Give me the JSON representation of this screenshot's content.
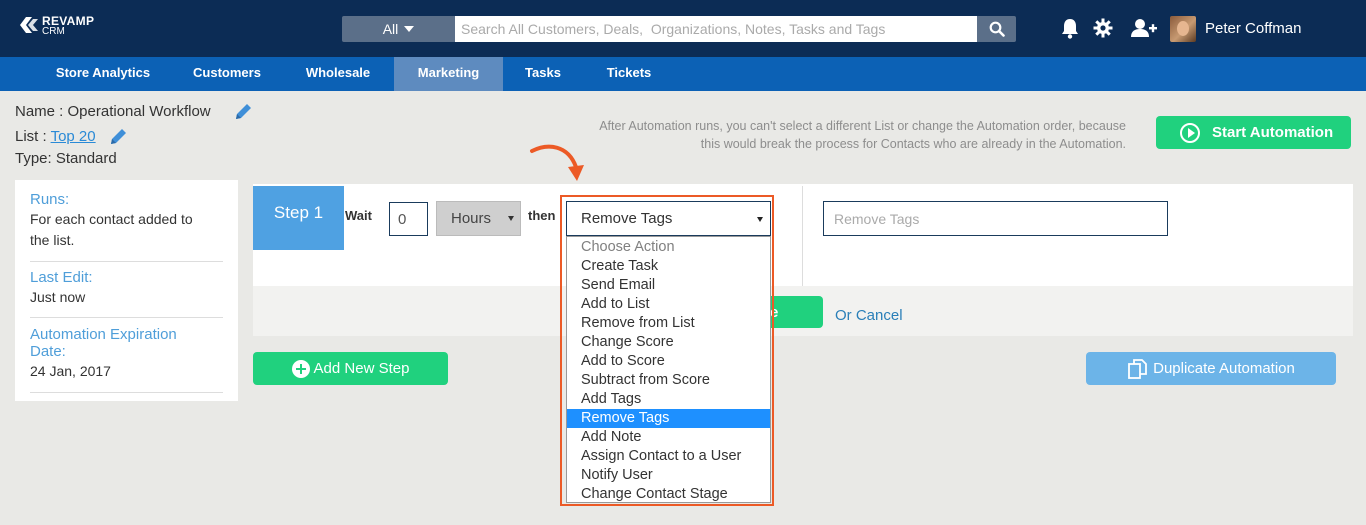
{
  "brand": {
    "line1": "REVAMP",
    "line2": "CRM"
  },
  "search": {
    "scope": "All",
    "placeholder": "Search All Customers, Deals,  Organizations, Notes, Tasks and Tags"
  },
  "user": {
    "name": "Peter Coffman"
  },
  "nav": {
    "items": [
      {
        "label": "Store Analytics"
      },
      {
        "label": "Customers"
      },
      {
        "label": "Wholesale"
      },
      {
        "label": "Marketing"
      },
      {
        "label": "Tasks"
      },
      {
        "label": "Tickets"
      }
    ],
    "active": "Marketing"
  },
  "automation": {
    "name_label": "Name : ",
    "name": "Operational Workflow",
    "list_label": "List : ",
    "list": "Top 20",
    "type_label": "Type: ",
    "type": "Standard",
    "notice_line1": "After Automation runs, you can't select a different List or change the Automation order, because",
    "notice_line2": "this would break the process for Contacts who are already in the Automation.",
    "start_label": "Start Automation"
  },
  "sidebar": {
    "runs_label": "Runs:",
    "runs_value_1": "For each contact added to",
    "runs_value_2": "the list.",
    "last_edit_label": "Last Edit:",
    "last_edit_value": "Just now",
    "expiration_label_1": "Automation Expiration",
    "expiration_label_2": "Date:",
    "expiration_value": "24 Jan, 2017"
  },
  "step": {
    "badge": "Step 1",
    "wait_label": "Wait",
    "wait_value": "0",
    "unit": "Hours",
    "then_label": "then",
    "action_selected": "Remove Tags",
    "tags_placeholder": "Remove Tags",
    "save_fragment": "e",
    "cancel_label": "Or Cancel",
    "actions": [
      "Choose Action",
      "Create Task",
      "Send Email",
      "Add to List",
      "Remove from List",
      "Change Score",
      "Add to Score",
      "Subtract from Score",
      "Add Tags",
      "Remove Tags",
      "Add Note",
      "Assign Contact to a User",
      "Notify User",
      "Change Contact Stage"
    ]
  },
  "buttons": {
    "add_step": "Add New Step",
    "duplicate": "Duplicate Automation"
  },
  "colors": {
    "topbar": "#0c2c55",
    "nav": "#0c61b5",
    "accent_green": "#20d17e",
    "highlight": "#ec5a26",
    "selected": "#1e90ff"
  },
  "icons": [
    "bell-icon",
    "gear-icon",
    "add-user-icon",
    "search-icon",
    "pencil-icon",
    "play-icon",
    "plus-circle-icon",
    "copy-icon"
  ]
}
